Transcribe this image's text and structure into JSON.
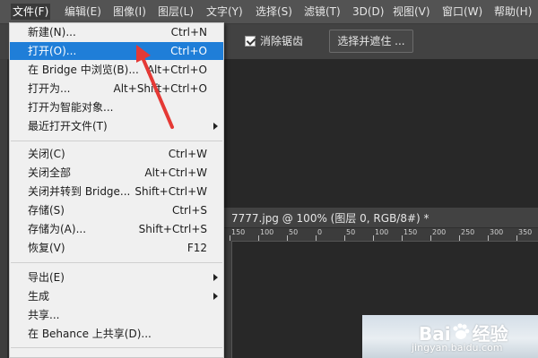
{
  "menubar": {
    "items": [
      "文件(F)",
      "编辑(E)",
      "图像(I)",
      "图层(L)",
      "文字(Y)",
      "选择(S)",
      "滤镜(T)",
      "3D(D)",
      "视图(V)",
      "窗口(W)",
      "帮助(H)"
    ],
    "active": "文件(F)"
  },
  "options_bar": {
    "antialias_label": "消除锯齿",
    "antialias_checked": true,
    "select_mask_button": "选择并遮住 ..."
  },
  "document": {
    "tab_title": "7777.jpg @ 100% (图层 0, RGB/8#) *",
    "ruler_ticks": [
      "150",
      "100",
      "50",
      "0",
      "50",
      "100",
      "150",
      "200",
      "250",
      "300",
      "350"
    ]
  },
  "file_menu": {
    "items": [
      {
        "label": "新建(N)...",
        "shortcut": "Ctrl+N"
      },
      {
        "label": "打开(O)...",
        "shortcut": "Ctrl+O",
        "highlighted": true
      },
      {
        "label": "在 Bridge 中浏览(B)...",
        "shortcut": "Alt+Ctrl+O"
      },
      {
        "label": "打开为...",
        "shortcut": "Alt+Shift+Ctrl+O"
      },
      {
        "label": "打开为智能对象...",
        "shortcut": ""
      },
      {
        "label": "最近打开文件(T)",
        "shortcut": "",
        "submenu": true
      },
      {
        "label": "关闭(C)",
        "shortcut": "Ctrl+W"
      },
      {
        "label": "关闭全部",
        "shortcut": "Alt+Ctrl+W"
      },
      {
        "label": "关闭并转到 Bridge...",
        "shortcut": "Shift+Ctrl+W"
      },
      {
        "label": "存储(S)",
        "shortcut": "Ctrl+S"
      },
      {
        "label": "存储为(A)...",
        "shortcut": "Shift+Ctrl+S"
      },
      {
        "label": "恢复(V)",
        "shortcut": "F12"
      },
      {
        "label": "导出(E)",
        "shortcut": "",
        "submenu": true
      },
      {
        "label": "生成",
        "shortcut": "",
        "submenu": true
      },
      {
        "label": "共享...",
        "shortcut": ""
      },
      {
        "label": "在 Behance 上共享(D)...",
        "shortcut": ""
      }
    ]
  },
  "watermark": {
    "logo_left": "Bai",
    "logo_right": "经验",
    "url": "jingyan.baidu.com"
  },
  "colors": {
    "highlight": "#1f7ed8",
    "annotation": "#e53935"
  }
}
